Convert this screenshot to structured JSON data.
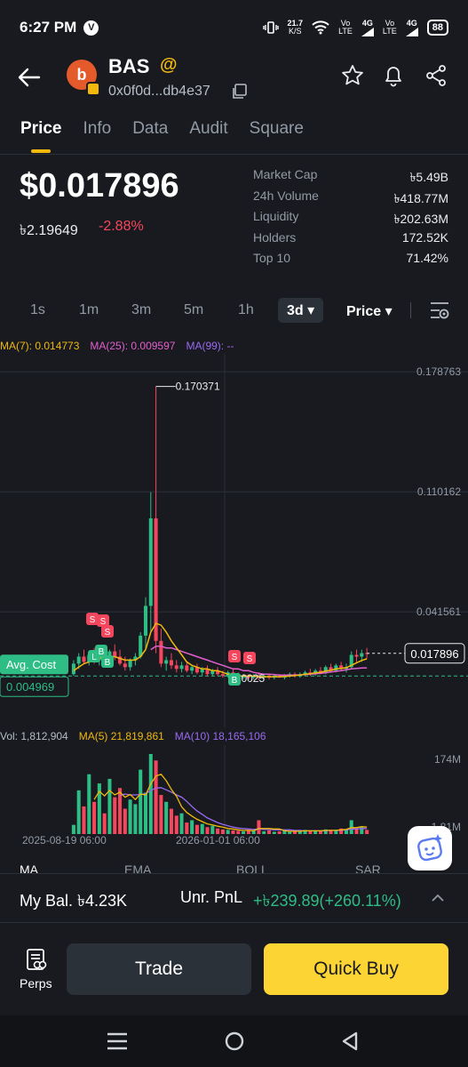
{
  "status_bar": {
    "time": "6:27 PM",
    "net_speed_top": "21.7",
    "net_speed_bottom": "K/S",
    "sim1_top": "Vo",
    "sim1_bottom": "LTE",
    "sim1_net": "4G",
    "sim2_top": "Vo",
    "sim2_bottom": "LTE",
    "sim2_net": "4G",
    "battery": "88"
  },
  "header": {
    "token_symbol": "BAS",
    "avatar_letter": "b",
    "address": "0x0f0d...db4e37"
  },
  "tabs": [
    "Price",
    "Info",
    "Data",
    "Audit",
    "Square"
  ],
  "price": {
    "usd": "$0.017896",
    "local": "৳2.19649",
    "change": "-2.88%"
  },
  "stats": [
    {
      "label": "Market Cap",
      "value": "৳5.49B"
    },
    {
      "label": "24h Volume",
      "value": "৳418.77M"
    },
    {
      "label": "Liquidity",
      "value": "৳202.63M"
    },
    {
      "label": "Holders",
      "value": "172.52K"
    },
    {
      "label": "Top 10",
      "value": "71.42%"
    }
  ],
  "intervals": [
    "1s",
    "1m",
    "3m",
    "5m",
    "1h",
    "3d"
  ],
  "active_interval": "3d",
  "price_mode": "Price",
  "ma_legend": {
    "ma7": "MA(7): 0.014773",
    "ma25": "MA(25): 0.009597",
    "ma99": "MA(99): --"
  },
  "vol_legend": {
    "vol": "Vol: 1,812,904",
    "ma5": "MA(5) 21,819,861",
    "ma10": "MA(10) 18,165,106"
  },
  "chart_data": {
    "type": "candlestick",
    "y_ticks": [
      "0.178763",
      "0.110162",
      "0.041561"
    ],
    "ylim": [
      0.0025,
      0.178763
    ],
    "high_label": "0.170371",
    "low_label": "0.0025",
    "current_price_label": "0.017896",
    "avg_cost_label": "Avg. Cost",
    "avg_cost_value": "0.004969",
    "x_ticks": [
      "2025-08-19 06:00",
      "2026-01-01 06:00"
    ],
    "volume_ticks": [
      "174M",
      "1.81M"
    ],
    "trade_markers": [
      "S",
      "S",
      "S",
      "L",
      "B",
      "B",
      "S",
      "S",
      "B"
    ],
    "candles": [
      {
        "o": 0.006,
        "h": 0.014,
        "l": 0.005,
        "c": 0.012
      },
      {
        "o": 0.012,
        "h": 0.018,
        "l": 0.009,
        "c": 0.016
      },
      {
        "o": 0.016,
        "h": 0.02,
        "l": 0.012,
        "c": 0.013
      },
      {
        "o": 0.013,
        "h": 0.019,
        "l": 0.011,
        "c": 0.017
      },
      {
        "o": 0.017,
        "h": 0.021,
        "l": 0.012,
        "c": 0.014
      },
      {
        "o": 0.014,
        "h": 0.019,
        "l": 0.011,
        "c": 0.018
      },
      {
        "o": 0.018,
        "h": 0.022,
        "l": 0.013,
        "c": 0.015
      },
      {
        "o": 0.015,
        "h": 0.02,
        "l": 0.012,
        "c": 0.019
      },
      {
        "o": 0.019,
        "h": 0.023,
        "l": 0.014,
        "c": 0.016
      },
      {
        "o": 0.016,
        "h": 0.02,
        "l": 0.011,
        "c": 0.012
      },
      {
        "o": 0.012,
        "h": 0.016,
        "l": 0.008,
        "c": 0.01
      },
      {
        "o": 0.01,
        "h": 0.015,
        "l": 0.008,
        "c": 0.014
      },
      {
        "o": 0.014,
        "h": 0.018,
        "l": 0.011,
        "c": 0.016
      },
      {
        "o": 0.016,
        "h": 0.03,
        "l": 0.015,
        "c": 0.028
      },
      {
        "o": 0.028,
        "h": 0.05,
        "l": 0.02,
        "c": 0.045
      },
      {
        "o": 0.045,
        "h": 0.11,
        "l": 0.03,
        "c": 0.095
      },
      {
        "o": 0.095,
        "h": 0.170371,
        "l": 0.018,
        "c": 0.025
      },
      {
        "o": 0.025,
        "h": 0.032,
        "l": 0.01,
        "c": 0.012
      },
      {
        "o": 0.012,
        "h": 0.016,
        "l": 0.008,
        "c": 0.014
      },
      {
        "o": 0.014,
        "h": 0.018,
        "l": 0.009,
        "c": 0.011
      },
      {
        "o": 0.011,
        "h": 0.014,
        "l": 0.007,
        "c": 0.009
      },
      {
        "o": 0.009,
        "h": 0.013,
        "l": 0.007,
        "c": 0.011
      },
      {
        "o": 0.011,
        "h": 0.013,
        "l": 0.007,
        "c": 0.008
      },
      {
        "o": 0.008,
        "h": 0.011,
        "l": 0.006,
        "c": 0.01
      },
      {
        "o": 0.01,
        "h": 0.012,
        "l": 0.006,
        "c": 0.007
      },
      {
        "o": 0.007,
        "h": 0.01,
        "l": 0.005,
        "c": 0.009
      },
      {
        "o": 0.009,
        "h": 0.011,
        "l": 0.005,
        "c": 0.006
      },
      {
        "o": 0.006,
        "h": 0.009,
        "l": 0.005,
        "c": 0.008
      },
      {
        "o": 0.008,
        "h": 0.01,
        "l": 0.005,
        "c": 0.006
      },
      {
        "o": 0.006,
        "h": 0.008,
        "l": 0.004,
        "c": 0.005
      },
      {
        "o": 0.005,
        "h": 0.008,
        "l": 0.004,
        "c": 0.007
      },
      {
        "o": 0.007,
        "h": 0.009,
        "l": 0.004,
        "c": 0.005
      },
      {
        "o": 0.005,
        "h": 0.007,
        "l": 0.003,
        "c": 0.004
      },
      {
        "o": 0.004,
        "h": 0.006,
        "l": 0.003,
        "c": 0.005
      },
      {
        "o": 0.005,
        "h": 0.006,
        "l": 0.003,
        "c": 0.004
      },
      {
        "o": 0.004,
        "h": 0.006,
        "l": 0.003,
        "c": 0.005
      },
      {
        "o": 0.005,
        "h": 0.007,
        "l": 0.0025,
        "c": 0.004
      },
      {
        "o": 0.004,
        "h": 0.006,
        "l": 0.003,
        "c": 0.005
      },
      {
        "o": 0.005,
        "h": 0.006,
        "l": 0.003,
        "c": 0.004
      },
      {
        "o": 0.004,
        "h": 0.006,
        "l": 0.003,
        "c": 0.005
      },
      {
        "o": 0.005,
        "h": 0.006,
        "l": 0.004,
        "c": 0.004
      },
      {
        "o": 0.004,
        "h": 0.006,
        "l": 0.003,
        "c": 0.005
      },
      {
        "o": 0.005,
        "h": 0.007,
        "l": 0.004,
        "c": 0.006
      },
      {
        "o": 0.006,
        "h": 0.007,
        "l": 0.004,
        "c": 0.005
      },
      {
        "o": 0.005,
        "h": 0.007,
        "l": 0.004,
        "c": 0.006
      },
      {
        "o": 0.006,
        "h": 0.008,
        "l": 0.005,
        "c": 0.007
      },
      {
        "o": 0.007,
        "h": 0.009,
        "l": 0.005,
        "c": 0.006
      },
      {
        "o": 0.006,
        "h": 0.009,
        "l": 0.005,
        "c": 0.008
      },
      {
        "o": 0.008,
        "h": 0.01,
        "l": 0.006,
        "c": 0.007
      },
      {
        "o": 0.007,
        "h": 0.011,
        "l": 0.006,
        "c": 0.01
      },
      {
        "o": 0.01,
        "h": 0.012,
        "l": 0.007,
        "c": 0.008
      },
      {
        "o": 0.008,
        "h": 0.012,
        "l": 0.007,
        "c": 0.011
      },
      {
        "o": 0.011,
        "h": 0.013,
        "l": 0.008,
        "c": 0.009
      },
      {
        "o": 0.009,
        "h": 0.012,
        "l": 0.007,
        "c": 0.01
      },
      {
        "o": 0.01,
        "h": 0.019,
        "l": 0.009,
        "c": 0.017
      },
      {
        "o": 0.017,
        "h": 0.02,
        "l": 0.013,
        "c": 0.016
      },
      {
        "o": 0.016,
        "h": 0.02,
        "l": 0.013,
        "c": 0.018
      },
      {
        "o": 0.018,
        "h": 0.021,
        "l": 0.015,
        "c": 0.017896
      }
    ],
    "volumes": [
      20,
      95,
      60,
      130,
      70,
      110,
      45,
      120,
      80,
      100,
      55,
      75,
      65,
      140,
      90,
      174,
      160,
      85,
      70,
      55,
      40,
      45,
      25,
      30,
      20,
      22,
      15,
      18,
      12,
      10,
      9,
      8,
      7,
      6,
      9,
      7,
      30,
      6,
      8,
      5,
      6,
      7,
      5,
      8,
      6,
      9,
      7,
      8,
      6,
      10,
      9,
      8,
      12,
      10,
      30,
      12,
      15,
      9
    ],
    "ma7": [
      0.008,
      0.01,
      0.012,
      0.013,
      0.014,
      0.015,
      0.016,
      0.016,
      0.016,
      0.015,
      0.014,
      0.014,
      0.014,
      0.016,
      0.02,
      0.03,
      0.035,
      0.034,
      0.03,
      0.025,
      0.021,
      0.017,
      0.013,
      0.011,
      0.01,
      0.009,
      0.009,
      0.008,
      0.008,
      0.007,
      0.006,
      0.006,
      0.005,
      0.005,
      0.005,
      0.005,
      0.0045,
      0.0045,
      0.0045,
      0.0045,
      0.0045,
      0.0046,
      0.005,
      0.0052,
      0.0055,
      0.006,
      0.0062,
      0.0068,
      0.007,
      0.0078,
      0.0082,
      0.009,
      0.0093,
      0.0097,
      0.011,
      0.0125,
      0.0138,
      0.014773
    ],
    "ma25": [
      null,
      null,
      null,
      null,
      null,
      null,
      null,
      null,
      null,
      null,
      null,
      null,
      null,
      null,
      null,
      0.02,
      0.022,
      0.022,
      0.021,
      0.021,
      0.02,
      0.019,
      0.018,
      0.017,
      0.016,
      0.015,
      0.014,
      0.013,
      0.012,
      0.011,
      0.01,
      0.009,
      0.009,
      0.008,
      0.008,
      0.007,
      0.0065,
      0.006,
      0.006,
      0.0058,
      0.0055,
      0.0055,
      0.0055,
      0.0055,
      0.0056,
      0.0058,
      0.006,
      0.0062,
      0.0065,
      0.0068,
      0.0072,
      0.0076,
      0.008,
      0.0085,
      0.009,
      0.0093,
      0.0095,
      0.009597
    ],
    "vol_ma5": [
      null,
      null,
      null,
      null,
      75,
      93,
      83,
      95,
      85,
      91,
      80,
      86,
      75,
      87,
      85,
      109,
      126,
      130,
      116,
      97,
      82,
      59,
      47,
      39,
      32,
      27,
      22,
      20,
      17,
      15,
      12,
      11,
      9,
      8,
      8,
      7,
      12,
      12,
      12,
      11,
      11,
      7,
      6,
      6,
      6,
      7,
      7,
      7,
      7,
      8,
      8,
      8,
      9,
      10,
      14,
      14,
      16,
      15
    ],
    "vol_ma10": [
      null,
      null,
      null,
      null,
      null,
      null,
      null,
      null,
      null,
      84,
      87,
      85,
      85,
      86,
      88,
      95,
      100,
      101,
      96,
      91,
      85,
      80,
      71,
      60,
      50,
      43,
      35,
      30,
      25,
      21,
      18,
      15,
      13,
      12,
      11,
      10,
      11,
      10,
      10,
      9,
      9,
      9,
      9,
      8,
      8,
      7,
      7,
      7,
      7,
      7,
      8,
      8,
      8,
      9,
      11,
      11,
      12,
      12
    ]
  },
  "indicators": [
    "MA",
    "EMA",
    "BOLL",
    "SAR"
  ],
  "balance": {
    "label": "My Bal. ৳4.23K",
    "unr_label": "Unr. PnL",
    "unr_value": "+৳239.89(+260.11%)"
  },
  "actions": {
    "perps_label": "Perps",
    "trade_label": "Trade",
    "quick_buy_label": "Quick Buy"
  },
  "colors": {
    "up": "#2ebd85",
    "down": "#f6465d",
    "accent": "#f0b90b",
    "ma7": "#f0b90b",
    "ma25": "#e35fce",
    "ma10": "#9a6af0",
    "background": "#181a20"
  }
}
